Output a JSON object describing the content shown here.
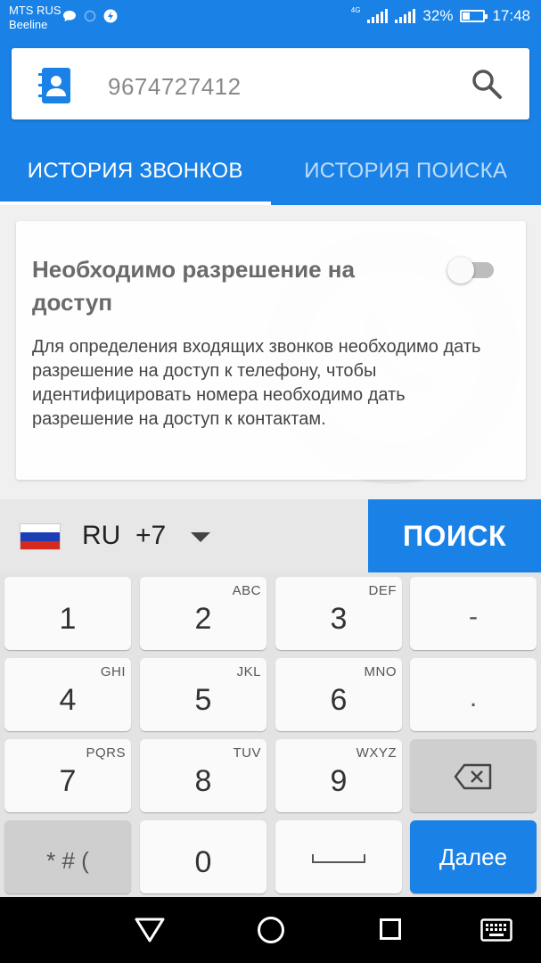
{
  "status_bar": {
    "carrier_1": "MTS RUS",
    "carrier_2": "Beeline",
    "network_type": "4G",
    "battery": "32%",
    "battery_level": 0.32,
    "time": "17:48"
  },
  "search": {
    "value": "9674727412"
  },
  "tabs": [
    {
      "label": "ИСТОРИЯ ЗВОНКОВ",
      "active": true
    },
    {
      "label": "ИСТОРИЯ ПОИСКА",
      "active": false
    }
  ],
  "permission_card": {
    "title": "Необходимо разрешение на доступ",
    "description": "Для определения входящих звонков необходимо дать разрешение на доступ к телефону, чтобы идентифицировать номера необходимо дать разрешение на доступ к контактам.",
    "toggle_on": false
  },
  "country": {
    "code": "RU",
    "dial": "+7"
  },
  "search_button": "ПОИСК",
  "keyboard": {
    "keys": [
      {
        "main": "1",
        "sub": ""
      },
      {
        "main": "2",
        "sub": "ABC"
      },
      {
        "main": "3",
        "sub": "DEF"
      },
      {
        "main": "-",
        "sub": ""
      },
      {
        "main": "4",
        "sub": "GHI"
      },
      {
        "main": "5",
        "sub": "JKL"
      },
      {
        "main": "6",
        "sub": "MNO"
      },
      {
        "main": ".",
        "sub": ""
      },
      {
        "main": "7",
        "sub": "PQRS"
      },
      {
        "main": "8",
        "sub": "TUV"
      },
      {
        "main": "9",
        "sub": "WXYZ"
      }
    ],
    "symbols": "* # (",
    "zero": "0",
    "next": "Далее"
  },
  "colors": {
    "accent": "#1a82e6",
    "flag_white": "#ffffff",
    "flag_blue": "#1c3fb5",
    "flag_red": "#d52b1e"
  },
  "icons": {
    "contact": "contact-book-icon",
    "search": "search-icon",
    "backspace": "backspace-icon"
  }
}
